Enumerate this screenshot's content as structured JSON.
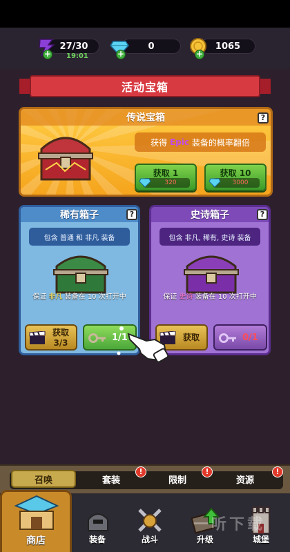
{
  "resources": {
    "energy": {
      "value": "27/30",
      "timer": "19:01",
      "icon": "energy-icon"
    },
    "gems": {
      "value": "0",
      "icon": "diamond-icon"
    },
    "coins": {
      "value": "1065",
      "icon": "coin-icon"
    },
    "plus": "+"
  },
  "banner": {
    "title": "活动宝箱"
  },
  "legendary": {
    "title": "传说宝箱",
    "help": "?",
    "desc_pre": "获得",
    "desc_highlight": "Epic",
    "desc_post": "装备的概率翻倍",
    "buy1": {
      "label": "获取 1",
      "cost": "320"
    },
    "buy10": {
      "label": "获取 10",
      "cost": "3000"
    }
  },
  "rare": {
    "title": "稀有箱子",
    "help": "?",
    "desc": "包含 普通 和 非凡 装备",
    "note_pre": "保证",
    "note_highlight": "非凡",
    "note_post": "装备在 10 次打开中",
    "ad_button": {
      "label": "获取",
      "count": "3/3"
    },
    "key_button": {
      "count": "1/1"
    }
  },
  "epic": {
    "title": "史诗箱子",
    "help": "?",
    "desc": "包含 非凡, 稀有, 史诗 装备",
    "note_pre": "保证",
    "note_highlight": "史诗",
    "note_post": "装备在 10 次打开中",
    "ad_button": {
      "label": "获取"
    },
    "key_button": {
      "count": "0/1"
    }
  },
  "tabs": [
    {
      "label": "召唤",
      "active": true
    },
    {
      "label": "套装",
      "alert": "!"
    },
    {
      "label": "限制",
      "alert": "!"
    },
    {
      "label": "资源",
      "alert": "!"
    }
  ],
  "nav": [
    {
      "label": "商店",
      "icon": "shop-icon"
    },
    {
      "label": "装备",
      "icon": "equipment-icon"
    },
    {
      "label": "战斗",
      "icon": "battle-icon"
    },
    {
      "label": "升级",
      "icon": "upgrade-icon"
    },
    {
      "label": "城堡",
      "icon": "castle-icon"
    }
  ],
  "watermark": "一听下载",
  "colors": {
    "legendary": "#f5a41d",
    "rare": "#7fb8e0",
    "epic": "#a072d4",
    "accent_green": "#4aa73a"
  }
}
